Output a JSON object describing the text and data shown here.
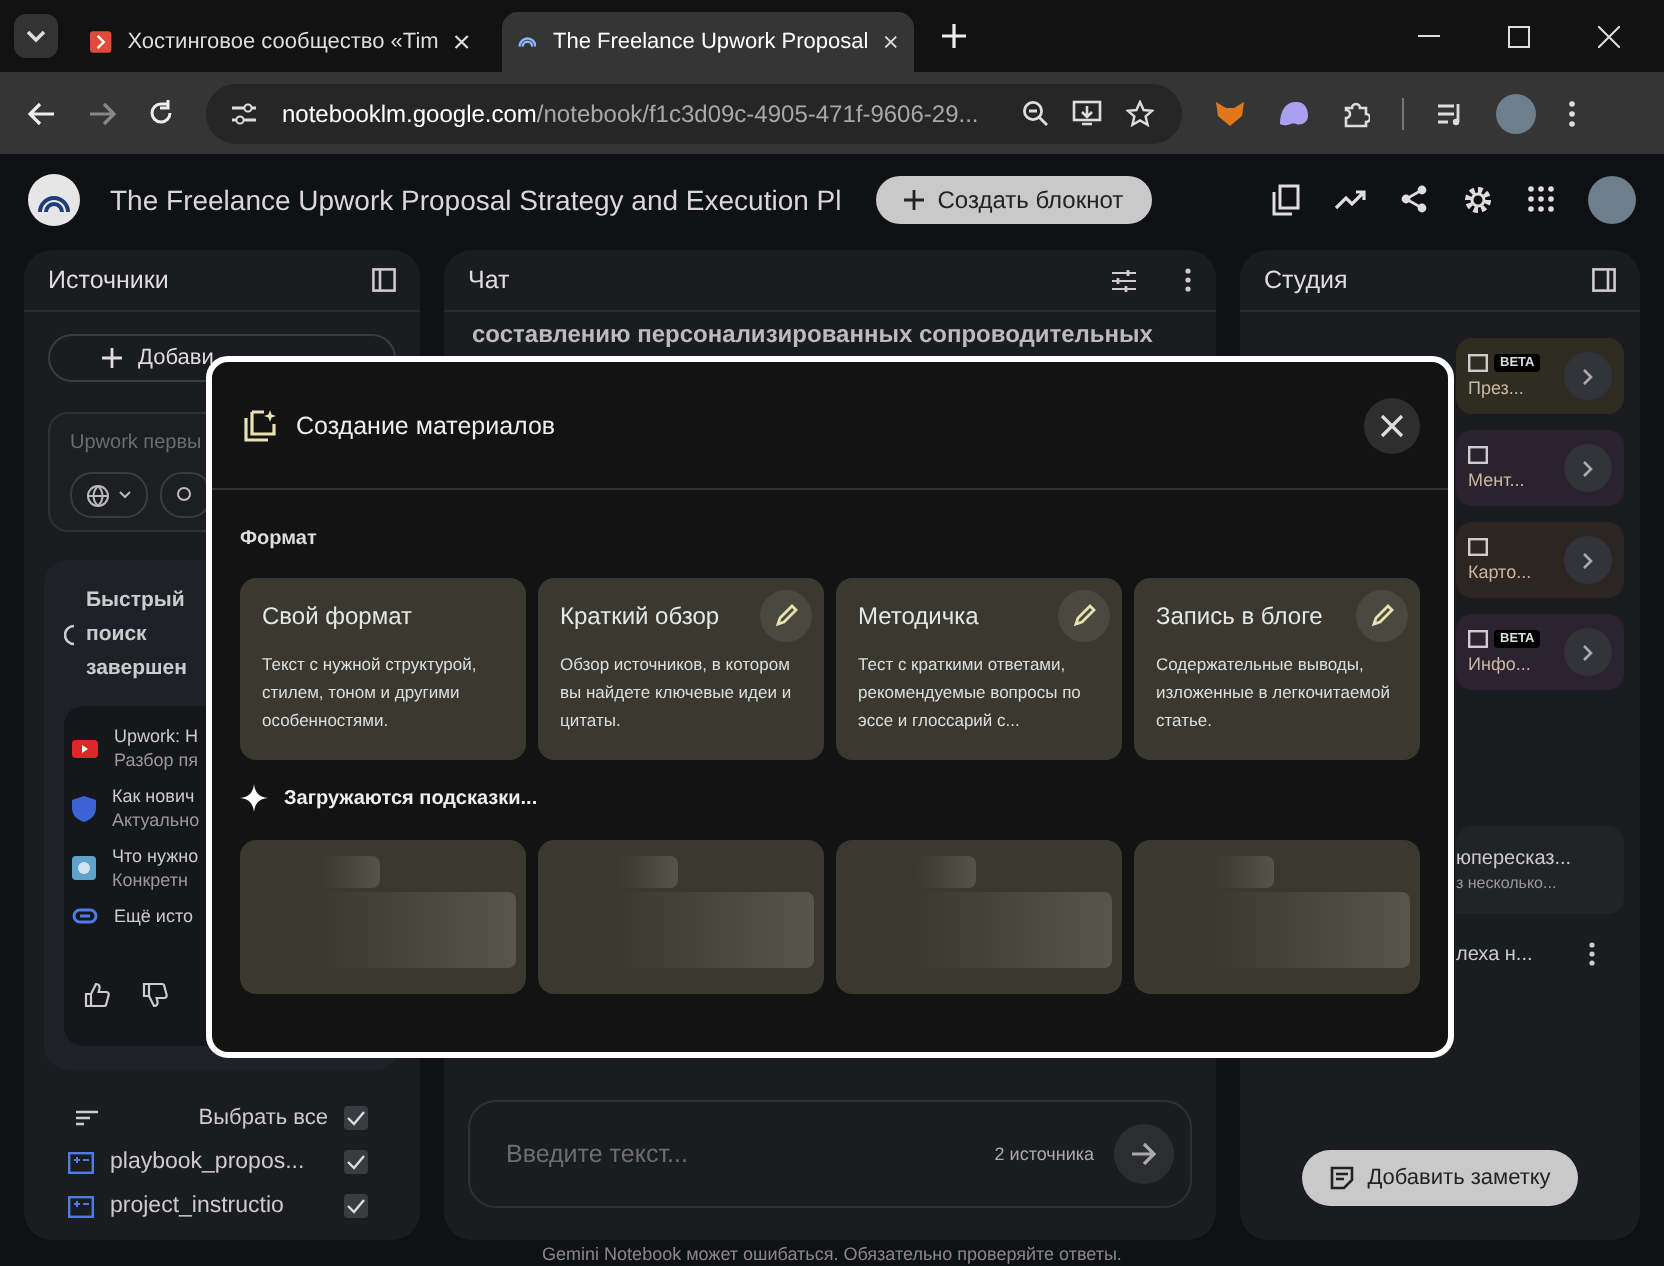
{
  "browser": {
    "tabs": [
      {
        "title": "Хостинговое сообщество «Tim",
        "selected": false
      },
      {
        "title": "The Freelance Upwork Proposal",
        "selected": true
      }
    ],
    "url_host": "notebooklm.google.com",
    "url_path": "/notebook/f1c3d09c-4905-471f-9606-29..."
  },
  "app_header": {
    "title": "The Freelance Upwork Proposal Strategy and Execution Pl",
    "create_button": "Создать блокнот"
  },
  "sources_panel": {
    "title": "Источники",
    "add_button": "Добави",
    "search_placeholder": "Upwork первы",
    "status": "Быстрый поиск завершен",
    "results": [
      {
        "kind": "video",
        "title": "Upwork: H",
        "subtitle": "Разбор пя"
      },
      {
        "kind": "shield",
        "title": "Как нович",
        "subtitle": "Актуально"
      },
      {
        "kind": "square",
        "title": "Что нужно",
        "subtitle": "Конкретн"
      }
    ],
    "more_link": "Ещё исто",
    "select_all": {
      "label": "Выбрать все",
      "checked": true
    },
    "sources": [
      {
        "name": "playbook_propos...",
        "checked": true
      },
      {
        "name": "project_instructio",
        "checked": true
      }
    ]
  },
  "chat": {
    "title": "Чат",
    "message_line": "составлению персонализированных сопроводительных",
    "input_placeholder": "Введите текст...",
    "source_count": "2 источника"
  },
  "studio": {
    "title": "Студия",
    "tools": [
      {
        "label": "През...",
        "badge": "BETA",
        "color": "#2f2d22"
      },
      {
        "label": "Мент...",
        "color": "#2b2230"
      },
      {
        "label": "Карто...",
        "color": "#2d2522"
      },
      {
        "label": "Инфо...",
        "badge": "BETA",
        "color": "#2d2230"
      }
    ],
    "notes": [
      {
        "title": "юпересказ...",
        "subtitle": "з несколько..."
      },
      {
        "title": "леха н..."
      }
    ],
    "add_note": "Добавить заметку"
  },
  "disclaimer": "Gemini Notebook может ошибаться. Обязательно проверяйте ответы.",
  "modal": {
    "title": "Создание материалов",
    "format_label": "Формат",
    "formats": [
      {
        "title": "Свой формат",
        "description": "Текст с нужной структурой, стилем, тоном и другими особенностями.",
        "editable": false
      },
      {
        "title": "Краткий обзор",
        "description": "Обзор источников, в котором вы найдете ключевые идеи и цитаты.",
        "editable": true
      },
      {
        "title": "Методичка",
        "description": "Тест с краткими ответами, рекомендуемые вопросы по эссе и глоссарий с...",
        "editable": true
      },
      {
        "title": "Запись в блоге",
        "description": "Содержательные выводы, изложенные в легкочитаемой статье.",
        "editable": true
      }
    ],
    "loading_label": "Загружаются подсказки...",
    "suggestions": [
      {
        "kind": "skeleton"
      },
      {
        "kind": "skeleton"
      },
      {
        "kind": "skeleton"
      },
      {
        "kind": "skeleton"
      }
    ]
  }
}
